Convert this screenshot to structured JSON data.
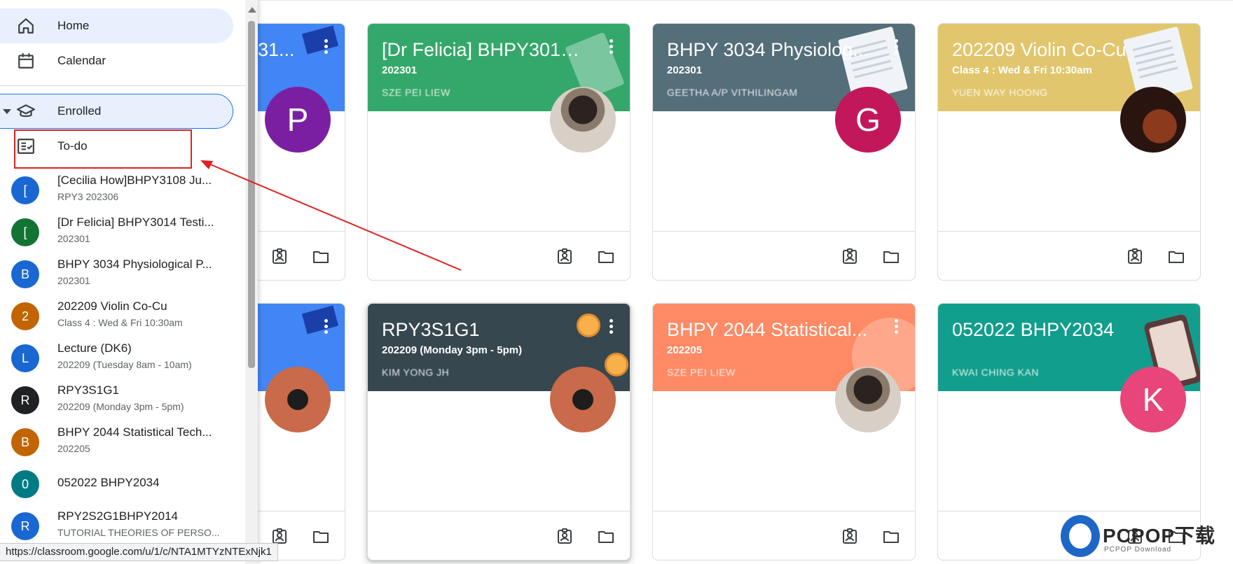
{
  "sidebar": {
    "nav": [
      {
        "label": "Home",
        "icon": "home-icon"
      },
      {
        "label": "Calendar",
        "icon": "calendar-icon"
      }
    ],
    "enrolled_label": "Enrolled",
    "todo_label": "To-do",
    "classes": [
      {
        "initial": "[",
        "name": "[Cecilia How]BHPY3108 Ju...",
        "subtitle": "RPY3 202306",
        "color": "#1967d2"
      },
      {
        "initial": "[",
        "name": "[Dr Felicia] BHPY3014 Testi...",
        "subtitle": "202301",
        "color": "#137333"
      },
      {
        "initial": "B",
        "name": "BHPY 3034 Physiological P...",
        "subtitle": "202301",
        "color": "#1967d2"
      },
      {
        "initial": "2",
        "name": "202209 Violin Co-Cu",
        "subtitle": "Class 4 : Wed & Fri 10:30am",
        "color": "#c26401"
      },
      {
        "initial": "L",
        "name": "Lecture (DK6)",
        "subtitle": "202209 (Tuesday 8am - 10am)",
        "color": "#1967d2"
      },
      {
        "initial": "R",
        "name": "RPY3S1G1",
        "subtitle": "202209 (Monday 3pm - 5pm)",
        "color": "#202124"
      },
      {
        "initial": "B",
        "name": "BHPY 2044 Statistical Tech...",
        "subtitle": "202205",
        "color": "#c26401"
      },
      {
        "initial": "0",
        "name": "052022 BHPY2034",
        "subtitle": "",
        "color": "#007b83"
      },
      {
        "initial": "R",
        "name": "RPY2S2G1BHPY2014",
        "subtitle": "TUTORIAL THEORIES OF PERSO...",
        "color": "#1967d2"
      }
    ]
  },
  "status_url": "https://classroom.google.com/u/1/c/NTA1MTYzNTExNjk1",
  "cards": [
    {
      "title": "31...",
      "section": "",
      "teacher": "",
      "color": "#4285f4",
      "avatar_letter": "P",
      "avatar_color": "#7b1fa2"
    },
    {
      "title": "[Dr Felicia] BHPY3014...",
      "section": "202301",
      "teacher": "SZE PEI LIEW",
      "color": "#34a86a",
      "avatar_letter": "",
      "avatar_color": "#6b5f58"
    },
    {
      "title": "BHPY 3034 Physiolog...",
      "section": "202301",
      "teacher": "GEETHA A/P VITHILINGAM",
      "color": "#546e7a",
      "avatar_letter": "G",
      "avatar_color": "#c2185b"
    },
    {
      "title": "202209 Violin Co-Cu",
      "section": "Class 4 : Wed & Fri 10:30am",
      "teacher": "YUEN WAY HOONG",
      "color": "#e2c66d",
      "avatar_letter": "",
      "avatar_color": "#5b2a1a"
    },
    {
      "title": "",
      "section": "",
      "teacher": "",
      "color": "#4285f4",
      "avatar_letter": "",
      "avatar_color": "#c96a4a"
    },
    {
      "title": "RPY3S1G1",
      "section": "202209 (Monday 3pm - 5pm)",
      "teacher": "KIM YONG JH",
      "color": "#37474f",
      "avatar_letter": "",
      "avatar_color": "#c96a4a"
    },
    {
      "title": "BHPY 2044 Statistical...",
      "section": "202205",
      "teacher": "SZE PEI LIEW",
      "color": "#ff8a65",
      "avatar_letter": "",
      "avatar_color": "#6b5f58"
    },
    {
      "title": "052022 BHPY2034",
      "section": "",
      "teacher": "KWAI CHING KAN",
      "color": "#129e8c",
      "avatar_letter": "K",
      "avatar_color": "#e8457a"
    }
  ],
  "watermark": {
    "brand": "PCPOP下载",
    "sub": "PCPOP Download"
  }
}
